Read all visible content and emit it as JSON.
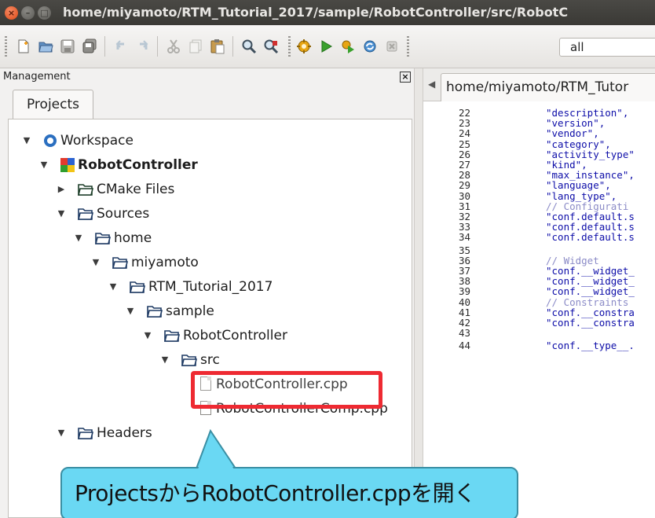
{
  "window": {
    "title": "home/miyamoto/RTM_Tutorial_2017/sample/RobotController/src/RobotC",
    "close_glyph": "×",
    "minimize_glyph": "–",
    "maximize_glyph": "□"
  },
  "toolbar": {
    "target_select_value": "all",
    "icons": [
      "new-file-icon",
      "open-icon",
      "save-icon",
      "save-all-icon",
      "undo-icon",
      "redo-icon",
      "cut-icon",
      "copy-icon",
      "paste-icon",
      "find-icon",
      "replace-icon",
      "build-icon",
      "run-icon",
      "build-and-run-icon",
      "rebuild-icon",
      "abort-icon"
    ]
  },
  "management": {
    "title": "Management",
    "close_glyph": "×",
    "tab_projects": "Projects"
  },
  "tree": {
    "workspace": "Workspace",
    "project": "RobotController",
    "cmake_files": "CMake Files",
    "sources": "Sources",
    "home": "home",
    "miyamoto": "miyamoto",
    "rtm_tutorial": "RTM_Tutorial_2017",
    "sample": "sample",
    "robotcontroller_dir": "RobotController",
    "src": "src",
    "file_main": "RobotController.cpp",
    "file_comp": "RobotControllerComp.cpp",
    "headers": "Headers"
  },
  "editor": {
    "tab_label": "home/miyamoto/RTM_Tutor",
    "tab_arrow": "◀",
    "lines": [
      {
        "n": "22",
        "t": "\"description\",",
        "c": false
      },
      {
        "n": "23",
        "t": "\"version\",",
        "c": false
      },
      {
        "n": "24",
        "t": "\"vendor\",",
        "c": false
      },
      {
        "n": "25",
        "t": "\"category\",",
        "c": false
      },
      {
        "n": "26",
        "t": "\"activity_type\"",
        "c": false
      },
      {
        "n": "27",
        "t": "\"kind\",",
        "c": false
      },
      {
        "n": "28",
        "t": "\"max_instance\",",
        "c": false
      },
      {
        "n": "29",
        "t": "\"language\",",
        "c": false
      },
      {
        "n": "30",
        "t": "\"lang_type\",",
        "c": false
      },
      {
        "n": "31",
        "t": "// Configurati",
        "c": true
      },
      {
        "n": "32",
        "t": "\"conf.default.s",
        "c": false
      },
      {
        "n": "33",
        "t": "\"conf.default.s",
        "c": false
      },
      {
        "n": "34",
        "t": "\"conf.default.s",
        "c": false
      },
      {
        "n": "35",
        "t": "",
        "c": false
      },
      {
        "n": "36",
        "t": "// Widget",
        "c": true
      },
      {
        "n": "37",
        "t": "\"conf.__widget_",
        "c": false
      },
      {
        "n": "38",
        "t": "\"conf.__widget_",
        "c": false
      },
      {
        "n": "39",
        "t": "\"conf.__widget_",
        "c": false
      },
      {
        "n": "40",
        "t": "// Constraints",
        "c": true
      },
      {
        "n": "41",
        "t": "\"conf.__constra",
        "c": false
      },
      {
        "n": "42",
        "t": "\"conf.__constra",
        "c": false
      },
      {
        "n": "43",
        "t": "",
        "c": false
      },
      {
        "n": "44",
        "t": "\"conf.__type__.",
        "c": false
      }
    ]
  },
  "callout": {
    "text": "ProjectsからRobotController.cppを開く",
    "color": "#6ad8f3"
  },
  "highlight_color": "#ee2a32"
}
